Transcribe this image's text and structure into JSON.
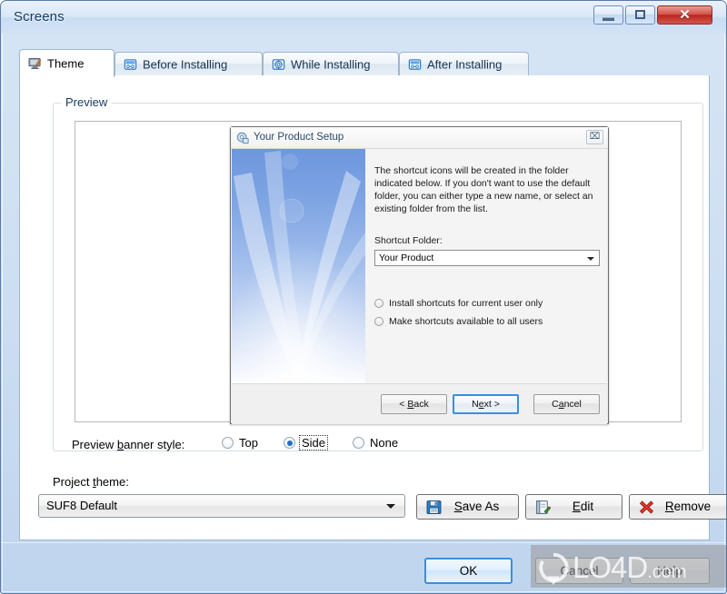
{
  "window": {
    "title": "Screens",
    "controls": {
      "minimize": "minimize",
      "maximize": "maximize",
      "close": "✕"
    }
  },
  "tabs": [
    {
      "label": "Theme",
      "icon": "screen-pen-icon",
      "active": true
    },
    {
      "label": "Before Installing",
      "icon": "dialog-icon",
      "active": false
    },
    {
      "label": "While Installing",
      "icon": "gear-disc-icon",
      "active": false
    },
    {
      "label": "After Installing",
      "icon": "dialog-icon",
      "active": false
    }
  ],
  "group": {
    "title": "Preview"
  },
  "setup_preview": {
    "title": "Your Product Setup",
    "title_icon": "setup-box-icon",
    "close_glyph": "⌧",
    "intro": "The shortcut icons will be created in the folder indicated below. If you don't want to use the default folder, you can either type a new name, or select an existing folder from the list.",
    "shortcut_label": "Shortcut Folder:",
    "shortcut_value": "Your Product",
    "radios": [
      {
        "label": "Install shortcuts for current user only",
        "checked": false
      },
      {
        "label": "Make shortcuts available to all users",
        "checked": false
      }
    ],
    "buttons": {
      "back": "< Back",
      "next_pre": "N",
      "next_key": "e",
      "next_post": "xt >",
      "cancel_pre": "C",
      "cancel_key": "a",
      "cancel_post": "ncel",
      "back_pre": "< ",
      "back_key": "B",
      "back_post": "ack"
    }
  },
  "banner_style": {
    "label_pre": "Preview ",
    "label_key": "b",
    "label_post": "anner style:",
    "options": [
      {
        "label": "Top",
        "checked": false,
        "focused": false
      },
      {
        "label": "Side",
        "checked": true,
        "focused": true
      },
      {
        "label": "None",
        "checked": false,
        "focused": false
      }
    ]
  },
  "project_theme": {
    "label_pre": "Project ",
    "label_key": "t",
    "label_post": "heme:",
    "value": "SUF8 Default",
    "actions": [
      {
        "label_pre": "",
        "label_key": "S",
        "label_post": "ave As",
        "icon": "floppy-disk-icon"
      },
      {
        "label_pre": "",
        "label_key": "E",
        "label_post": "dit",
        "icon": "edit-note-icon"
      },
      {
        "label_pre": "",
        "label_key": "R",
        "label_post": "emove",
        "icon": "red-x-icon"
      }
    ]
  },
  "footer": {
    "ok": "OK",
    "cancel": "Cancel",
    "help": "Help"
  },
  "watermark": {
    "text": "LO4D",
    "suffix": ".com",
    "logo": "refresh-circle-icon"
  },
  "colors": {
    "accent_blue": "#1f6fc4",
    "focus_blue": "#3c8edb",
    "close_red": "#bb251e",
    "title_text": "#123a63",
    "banner_blue": "#7ba2e2"
  }
}
